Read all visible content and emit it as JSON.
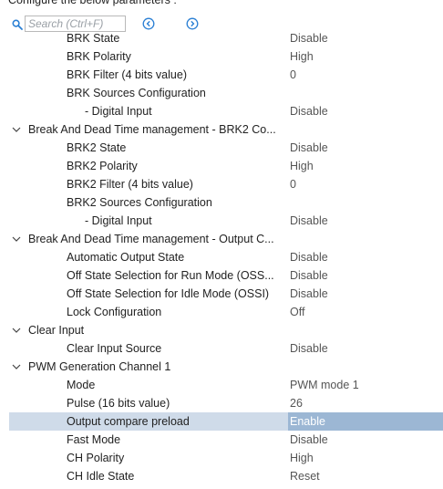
{
  "header": {
    "text": "Configure the below parameters :"
  },
  "search": {
    "placeholder": "Search (Ctrl+F)",
    "search_icon": "search-icon",
    "prev_icon": "arrow-left-circle-icon",
    "next_icon": "arrow-right-circle-icon"
  },
  "colors": {
    "selected_row": "#cfdbe9",
    "selected_value": "#9cb7d4",
    "icon_blue": "#2a7fd4"
  },
  "rows": [
    {
      "kind": "param",
      "label": "BRK State",
      "value": "Disable"
    },
    {
      "kind": "param",
      "label": "BRK Polarity",
      "value": "High"
    },
    {
      "kind": "param",
      "label": "BRK Filter (4 bits value)",
      "value": "0"
    },
    {
      "kind": "param",
      "label": "BRK Sources Configuration",
      "value": ""
    },
    {
      "kind": "sub",
      "label": "- Digital Input",
      "value": "Disable"
    },
    {
      "kind": "group",
      "label": "Break And Dead Time management - BRK2 Co...",
      "value": ""
    },
    {
      "kind": "param",
      "label": "BRK2 State",
      "value": "Disable"
    },
    {
      "kind": "param",
      "label": "BRK2 Polarity",
      "value": "High"
    },
    {
      "kind": "param",
      "label": "BRK2 Filter (4 bits value)",
      "value": "0"
    },
    {
      "kind": "param",
      "label": "BRK2 Sources Configuration",
      "value": ""
    },
    {
      "kind": "sub",
      "label": "- Digital Input",
      "value": "Disable"
    },
    {
      "kind": "group",
      "label": "Break And Dead Time management - Output C...",
      "value": ""
    },
    {
      "kind": "param",
      "label": "Automatic Output State",
      "value": "Disable"
    },
    {
      "kind": "param",
      "label": "Off State Selection for Run Mode (OSS...",
      "value": "Disable"
    },
    {
      "kind": "param",
      "label": "Off State Selection for Idle Mode (OSSI)",
      "value": "Disable"
    },
    {
      "kind": "param",
      "label": "Lock Configuration",
      "value": "Off"
    },
    {
      "kind": "group",
      "label": "Clear Input",
      "value": ""
    },
    {
      "kind": "param",
      "label": "Clear Input Source",
      "value": "Disable"
    },
    {
      "kind": "group",
      "label": "PWM Generation Channel 1",
      "value": ""
    },
    {
      "kind": "param",
      "label": "Mode",
      "value": "PWM mode 1"
    },
    {
      "kind": "param",
      "label": "Pulse (16 bits value)",
      "value": "26"
    },
    {
      "kind": "param",
      "label": "Output compare preload",
      "value": "Enable",
      "selected": true
    },
    {
      "kind": "param",
      "label": "Fast Mode",
      "value": "Disable"
    },
    {
      "kind": "param",
      "label": "CH Polarity",
      "value": "High"
    },
    {
      "kind": "param",
      "label": "CH Idle State",
      "value": "Reset"
    }
  ]
}
